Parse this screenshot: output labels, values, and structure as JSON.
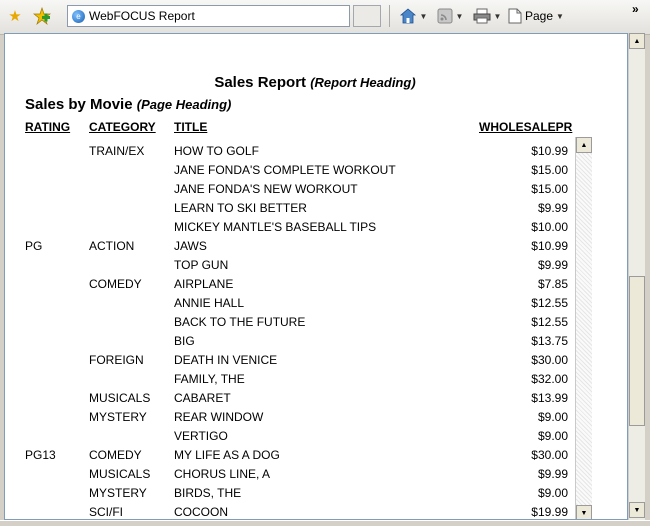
{
  "browser": {
    "tab_title": "WebFOCUS Report",
    "page_menu_label": "Page",
    "chevron": "»"
  },
  "report": {
    "report_heading": "Sales Report",
    "report_heading_note": "(Report Heading)",
    "page_heading": "Sales by Movie",
    "page_heading_note": "(Page Heading)",
    "columns": {
      "rating": "RATING",
      "category": "CATEGORY",
      "title": "TITLE",
      "price": "WHOLESALEPR"
    },
    "rows": [
      {
        "rating": "",
        "category": "TRAIN/EX",
        "title": "HOW TO GOLF",
        "price": "$10.99"
      },
      {
        "rating": "",
        "category": "",
        "title": "JANE FONDA'S COMPLETE WORKOUT",
        "price": "$15.00"
      },
      {
        "rating": "",
        "category": "",
        "title": "JANE FONDA'S NEW WORKOUT",
        "price": "$15.00"
      },
      {
        "rating": "",
        "category": "",
        "title": "LEARN TO SKI BETTER",
        "price": "$9.99"
      },
      {
        "rating": "",
        "category": "",
        "title": "MICKEY MANTLE'S BASEBALL TIPS",
        "price": "$10.00"
      },
      {
        "rating": "PG",
        "category": "ACTION",
        "title": "JAWS",
        "price": "$10.99"
      },
      {
        "rating": "",
        "category": "",
        "title": "TOP GUN",
        "price": "$9.99"
      },
      {
        "rating": "",
        "category": "COMEDY",
        "title": "AIRPLANE",
        "price": "$7.85"
      },
      {
        "rating": "",
        "category": "",
        "title": "ANNIE HALL",
        "price": "$12.55"
      },
      {
        "rating": "",
        "category": "",
        "title": "BACK TO THE FUTURE",
        "price": "$12.55"
      },
      {
        "rating": "",
        "category": "",
        "title": "BIG",
        "price": "$13.75"
      },
      {
        "rating": "",
        "category": "FOREIGN",
        "title": "DEATH IN VENICE",
        "price": "$30.00"
      },
      {
        "rating": "",
        "category": "",
        "title": "FAMILY, THE",
        "price": "$32.00"
      },
      {
        "rating": "",
        "category": "MUSICALS",
        "title": "CABARET",
        "price": "$13.99"
      },
      {
        "rating": "",
        "category": "MYSTERY",
        "title": "REAR WINDOW",
        "price": "$9.00"
      },
      {
        "rating": "",
        "category": "",
        "title": "VERTIGO",
        "price": "$9.00"
      },
      {
        "rating": "PG13",
        "category": "COMEDY",
        "title": "MY LIFE AS A DOG",
        "price": "$30.00"
      },
      {
        "rating": "",
        "category": "MUSICALS",
        "title": "CHORUS LINE, A",
        "price": "$9.99"
      },
      {
        "rating": "",
        "category": "MYSTERY",
        "title": "BIRDS, THE",
        "price": "$9.00"
      },
      {
        "rating": "",
        "category": "SCI/FI",
        "title": "COCOON",
        "price": "$19.99"
      }
    ]
  },
  "icons": {
    "favorites": "star-icon",
    "add_favorites": "add-favorite-icon",
    "home": "home-icon",
    "feeds": "rss-icon",
    "print": "printer-icon",
    "page": "page-icon"
  },
  "colors": {
    "chrome": "#d4d0c8",
    "content_bg": "#ffffff",
    "border": "#7f9db9"
  }
}
